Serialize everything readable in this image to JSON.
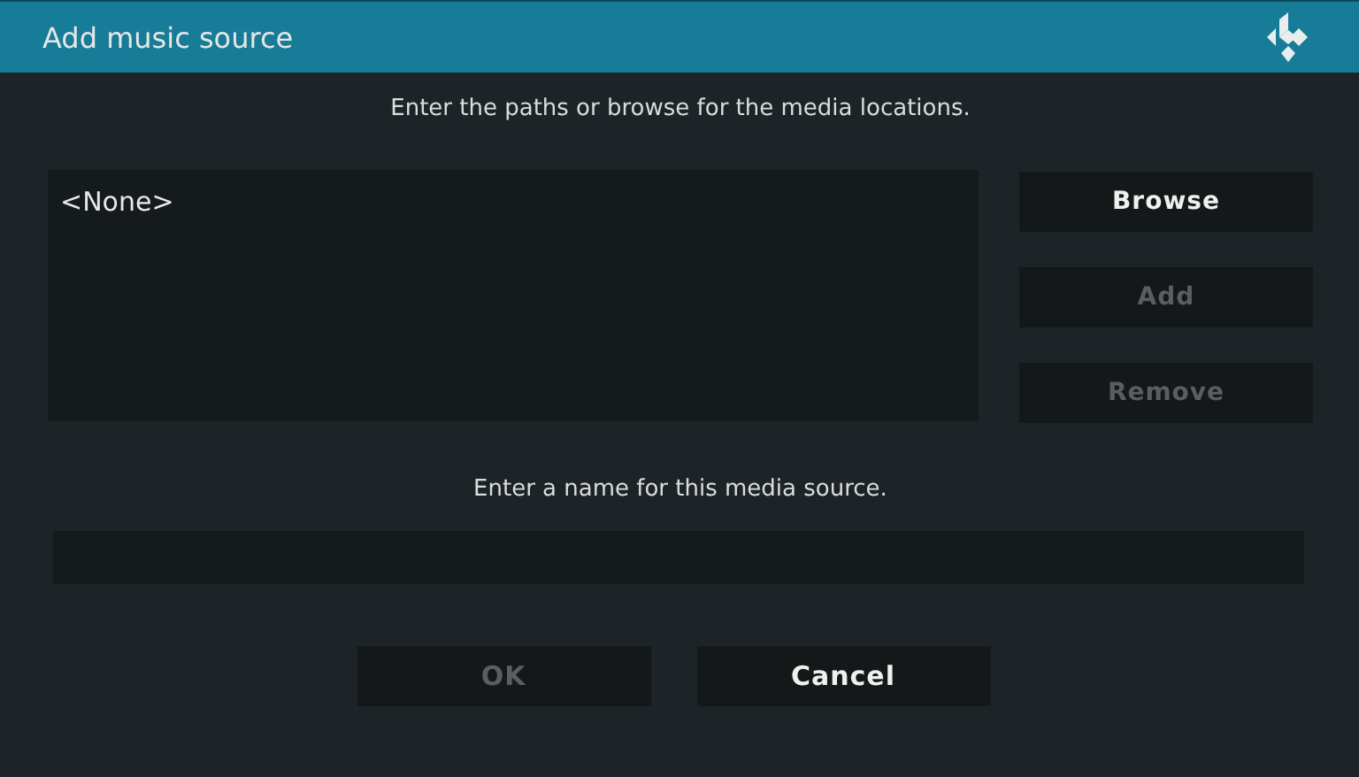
{
  "window": {
    "title": "Add music source"
  },
  "paths_prompt": "Enter the paths or browse for the media locations.",
  "paths_list": {
    "items": [
      "<None>"
    ]
  },
  "side_buttons": [
    {
      "label": "Browse",
      "disabled": false
    },
    {
      "label": "Add",
      "disabled": true
    },
    {
      "label": "Remove",
      "disabled": true
    }
  ],
  "name_prompt": "Enter a name for this media source.",
  "dialog_buttons": [
    {
      "label": "OK",
      "disabled": true
    },
    {
      "label": "Cancel",
      "disabled": false
    }
  ]
}
